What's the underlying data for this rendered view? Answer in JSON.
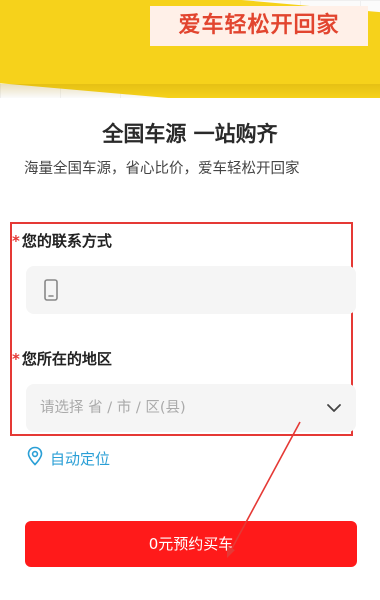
{
  "banner": {
    "slogan": "爱车轻松开回家"
  },
  "header": {
    "title": "全国车源 一站购齐",
    "subtitle": "海量全国车源，省心比价，爱车轻松开回家"
  },
  "form": {
    "required_mark": "*",
    "contact_label": "您的联系方式",
    "contact_value": "",
    "region_label": "您所在的地区",
    "region_placeholder": "请选择 省 / 市 / 区(县)"
  },
  "locate": {
    "label": "自动定位",
    "icon": "location-pin-icon"
  },
  "submit": {
    "label": "0元预约买车"
  },
  "colors": {
    "accent": "#ff1a1a",
    "highlight": "#e53935",
    "link": "#2a9fd6",
    "banner": "#f6d21b"
  }
}
